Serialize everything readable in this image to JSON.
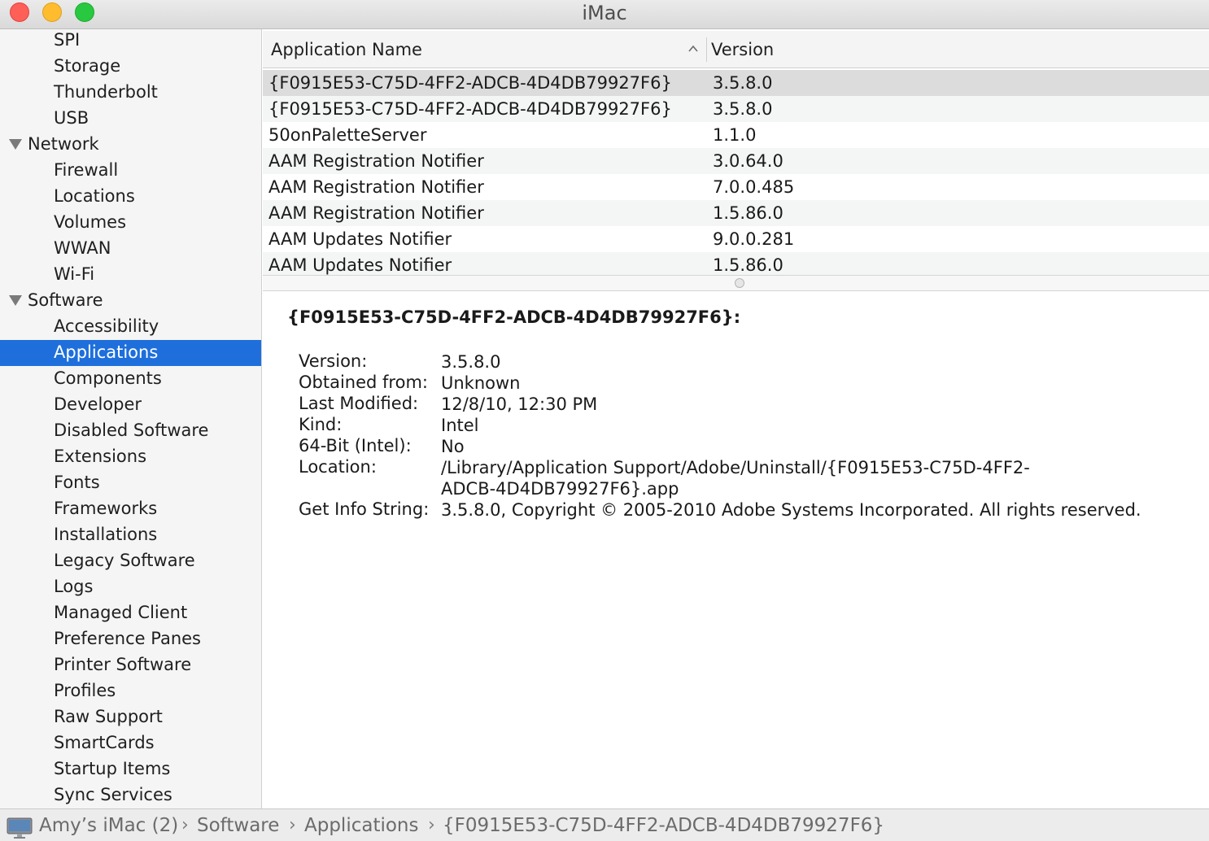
{
  "window": {
    "title": "iMac"
  },
  "sidebar": {
    "items": [
      {
        "label": "SPI",
        "level": "child"
      },
      {
        "label": "Storage",
        "level": "child"
      },
      {
        "label": "Thunderbolt",
        "level": "child"
      },
      {
        "label": "USB",
        "level": "child"
      },
      {
        "label": "Network",
        "level": "group"
      },
      {
        "label": "Firewall",
        "level": "child"
      },
      {
        "label": "Locations",
        "level": "child"
      },
      {
        "label": "Volumes",
        "level": "child"
      },
      {
        "label": "WWAN",
        "level": "child"
      },
      {
        "label": "Wi-Fi",
        "level": "child"
      },
      {
        "label": "Software",
        "level": "group"
      },
      {
        "label": "Accessibility",
        "level": "child"
      },
      {
        "label": "Applications",
        "level": "child",
        "selected": true
      },
      {
        "label": "Components",
        "level": "child"
      },
      {
        "label": "Developer",
        "level": "child"
      },
      {
        "label": "Disabled Software",
        "level": "child"
      },
      {
        "label": "Extensions",
        "level": "child"
      },
      {
        "label": "Fonts",
        "level": "child"
      },
      {
        "label": "Frameworks",
        "level": "child"
      },
      {
        "label": "Installations",
        "level": "child"
      },
      {
        "label": "Legacy Software",
        "level": "child"
      },
      {
        "label": "Logs",
        "level": "child"
      },
      {
        "label": "Managed Client",
        "level": "child"
      },
      {
        "label": "Preference Panes",
        "level": "child"
      },
      {
        "label": "Printer Software",
        "level": "child"
      },
      {
        "label": "Profiles",
        "level": "child"
      },
      {
        "label": "Raw Support",
        "level": "child"
      },
      {
        "label": "SmartCards",
        "level": "child"
      },
      {
        "label": "Startup Items",
        "level": "child"
      },
      {
        "label": "Sync Services",
        "level": "child"
      }
    ]
  },
  "table": {
    "columns": {
      "name": "Application Name",
      "version": "Version"
    },
    "sort_indicator": "chevron-up-icon",
    "rows": [
      {
        "name": "{F0915E53-C75D-4FF2-ADCB-4D4DB79927F6}",
        "version": "3.5.8.0",
        "selected": true
      },
      {
        "name": "{F0915E53-C75D-4FF2-ADCB-4D4DB79927F6}",
        "version": "3.5.8.0"
      },
      {
        "name": "50onPaletteServer",
        "version": "1.1.0"
      },
      {
        "name": "AAM Registration Notifier",
        "version": "3.0.64.0"
      },
      {
        "name": "AAM Registration Notifier",
        "version": "7.0.0.485"
      },
      {
        "name": "AAM Registration Notifier",
        "version": "1.5.86.0"
      },
      {
        "name": "AAM Updates Notifier",
        "version": "9.0.0.281"
      },
      {
        "name": "AAM Updates Notifier",
        "version": "1.5.86.0"
      }
    ]
  },
  "detail": {
    "title": "{F0915E53-C75D-4FF2-ADCB-4D4DB79927F6}:",
    "fields": {
      "version_label": "Version:",
      "version_value": "3.5.8.0",
      "obtained_label": "Obtained from:",
      "obtained_value": "Unknown",
      "modified_label": "Last Modified:",
      "modified_value": "12/8/10, 12:30 PM",
      "kind_label": "Kind:",
      "kind_value": "Intel",
      "bit_label": "64-Bit (Intel):",
      "bit_value": "No",
      "location_label": "Location:",
      "location_value_line1": "/Library/Application Support/Adobe/Uninstall/{F0915E53-C75D-4FF2-",
      "location_value_line2": "ADCB-4D4DB79927F6}.app",
      "info_label": "Get Info String:",
      "info_value": "3.5.8.0, Copyright © 2005-2010 Adobe Systems Incorporated. All rights reserved."
    }
  },
  "pathbar": {
    "icon": "imac-icon",
    "crumbs": [
      "Amy’s iMac (2)",
      "Software",
      "Applications",
      "{F0915E53-C75D-4FF2-ADCB-4D4DB79927F6}"
    ],
    "separator": "›"
  },
  "colors": {
    "selection": "#1e6fdc",
    "row_selected": "#dcdcdc",
    "row_alt": "#f4f5f5",
    "sidebar_bg": "#f5f5f5"
  }
}
